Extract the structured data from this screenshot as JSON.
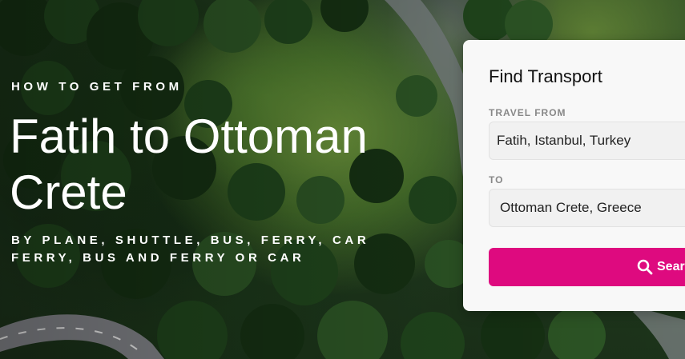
{
  "hero": {
    "eyebrow": "HOW TO GET FROM",
    "title": "Fatih to Ottoman Crete",
    "subtitle": "BY PLANE, SHUTTLE, BUS, FERRY, CAR FERRY, BUS AND FERRY OR CAR"
  },
  "panel": {
    "title": "Find Transport",
    "from_label": "TRAVEL FROM",
    "from_value": "Fatih, Istanbul, Turkey",
    "to_label": "TO",
    "to_value": "Ottoman Crete, Greece",
    "search_label": "Search",
    "search_icon": "search-icon"
  },
  "colors": {
    "accent": "#de0a7f",
    "panel_bg": "#f8f8f8",
    "field_bg": "#f1f1f1"
  }
}
